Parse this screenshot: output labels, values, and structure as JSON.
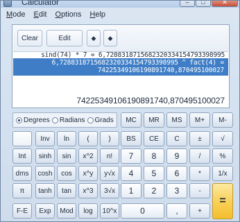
{
  "window": {
    "title": "Calculator",
    "minimize": "–",
    "maximize": "□",
    "close": "✕"
  },
  "menu": [
    "Mode",
    "Edit",
    "Options",
    "Help"
  ],
  "display": {
    "toolbar": {
      "clear": "Clear",
      "edit": "Edit",
      "up": "◆",
      "down": "◆"
    },
    "history": [
      "sind(74) * 7 = 6,72883187156823203341547933989​95",
      "6,72883187156823203341547933989​95 ^ fact(4) =",
      "7422534910619089174​0,870495100027"
    ],
    "result": "74225349106190891740,870495100027"
  },
  "angle_mode": {
    "options": [
      "Degrees",
      "Radians",
      "Grads"
    ],
    "selected": "Degrees"
  },
  "memory": [
    "MC",
    "MR",
    "MS",
    "M+",
    "M-"
  ],
  "keys": {
    "row1": [
      "",
      "Inv",
      "ln",
      "(",
      ")",
      "BS",
      "CE",
      "C",
      "±",
      "√"
    ],
    "row2": [
      "Int",
      "sinh",
      "sin",
      "x^2",
      "n!",
      "7",
      "8",
      "9",
      "/",
      "%"
    ],
    "row3": [
      "dms",
      "cosh",
      "cos",
      "x^y",
      "y√x",
      "4",
      "5",
      "6",
      "*",
      "1/x"
    ],
    "row4": [
      "π",
      "tanh",
      "tan",
      "x^3",
      "3√x",
      "1",
      "2",
      "3",
      "-",
      "="
    ],
    "row5": [
      "F-E",
      "Exp",
      "Mod",
      "log",
      "10^x",
      "0",
      ",",
      "+"
    ]
  }
}
